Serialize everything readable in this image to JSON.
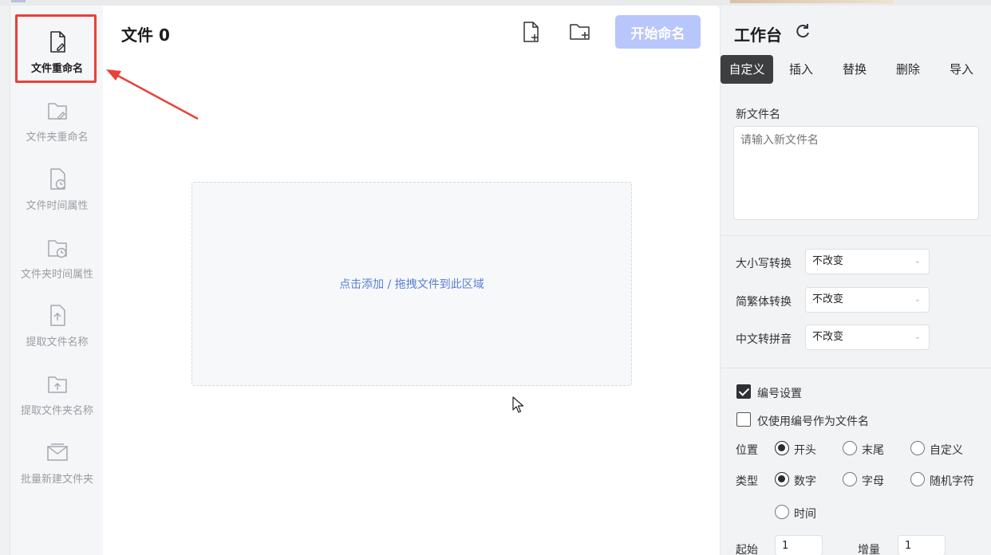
{
  "sidebar": {
    "items": [
      {
        "label": "文件重命名",
        "icon": "file-edit-icon",
        "active": true
      },
      {
        "label": "文件夹重命名",
        "icon": "folder-edit-icon"
      },
      {
        "label": "文件时间属性",
        "icon": "file-clock-icon"
      },
      {
        "label": "文件夹时间属性",
        "icon": "folder-clock-icon"
      },
      {
        "label": "提取文件名称",
        "icon": "file-upload-icon"
      },
      {
        "label": "提取文件夹名称",
        "icon": "folder-upload-icon"
      },
      {
        "label": "批量新建文件夹",
        "icon": "folder-batch-icon"
      }
    ]
  },
  "main": {
    "file_count_label": "文件 0",
    "add_file_icon": "file-add-icon",
    "add_folder_icon": "folder-add-icon",
    "start_button": "开始命名",
    "dropzone_text": "点击添加 / 拖拽文件到此区域"
  },
  "panel": {
    "title": "工作台",
    "refresh_icon": "refresh-icon",
    "tabs": [
      "自定义",
      "插入",
      "替换",
      "删除",
      "导入"
    ],
    "active_tab": "自定义",
    "new_name_label": "新文件名",
    "new_name_placeholder": "请输入新文件名",
    "case_label": "大小写转换",
    "case_value": "不改变",
    "trad_label": "简繁体转换",
    "trad_value": "不改变",
    "pinyin_label": "中文转拼音",
    "pinyin_value": "不改变",
    "numbering_label": "编号设置",
    "numbering_checked": true,
    "only_number_label": "仅使用编号作为文件名",
    "only_number_checked": false,
    "position_label": "位置",
    "position_options": [
      "开头",
      "末尾",
      "自定义"
    ],
    "position_selected": "开头",
    "type_label": "类型",
    "type_options": [
      "数字",
      "字母",
      "随机字符",
      "时间"
    ],
    "type_selected": "数字",
    "start_label": "起始",
    "start_value": "1",
    "step_label": "增量",
    "step_value": "1"
  },
  "colors": {
    "accent_disabled": "#b8c6fb",
    "highlight": "#e8413a",
    "link": "#5a7fd4"
  }
}
